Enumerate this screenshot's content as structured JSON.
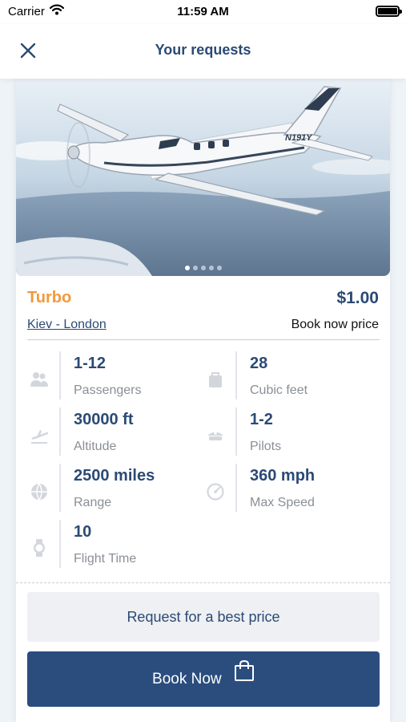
{
  "status_bar": {
    "carrier": "Carrier",
    "time": "11:59 AM"
  },
  "header": {
    "title": "Your requests"
  },
  "gallery": {
    "slide_count": 5,
    "active_slide": 1,
    "tail_number": "N191Y"
  },
  "aircraft": {
    "type": "Turbo",
    "price": "$1.00",
    "route": "Kiev - London",
    "price_label": "Book now price"
  },
  "specs": {
    "passengers": {
      "value": "1-12",
      "label": "Passengers",
      "icon": "passengers-icon"
    },
    "cubic_feet": {
      "value": "28",
      "label": "Cubic feet",
      "icon": "luggage-icon"
    },
    "altitude": {
      "value": "30000 ft",
      "label": "Altitude",
      "icon": "plane-takeoff-icon"
    },
    "pilots": {
      "value": "1-2",
      "label": "Pilots",
      "icon": "pilot-cap-icon"
    },
    "range": {
      "value": "2500 miles",
      "label": "Range",
      "icon": "globe-icon"
    },
    "max_speed": {
      "value": "360 mph",
      "label": "Max Speed",
      "icon": "speedometer-icon"
    },
    "flight_time": {
      "value": "10",
      "label": "Flight Time",
      "icon": "watch-icon"
    }
  },
  "actions": {
    "request_label": "Request for a best price",
    "book_label": "Book Now"
  },
  "colors": {
    "primary": "#2b4d7e",
    "accent": "#f3993e",
    "text_primary": "#2b4a75",
    "text_muted": "#8a8f97"
  }
}
